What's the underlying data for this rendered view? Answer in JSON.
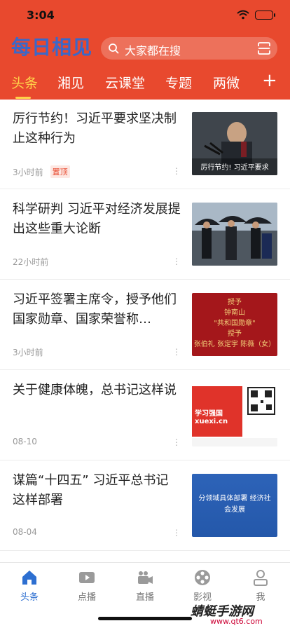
{
  "status_bar": {
    "time": "3:04"
  },
  "header": {
    "logo": "每日相见",
    "search_placeholder": "大家都在搜",
    "tabs": [
      {
        "label": "头条",
        "active": true
      },
      {
        "label": "湘见",
        "active": false
      },
      {
        "label": "云课堂",
        "active": false
      },
      {
        "label": "专题",
        "active": false
      },
      {
        "label": "两微",
        "active": false
      }
    ],
    "plus_label": "+"
  },
  "news": [
    {
      "title": "厉行节约！习近平要求坚决制止这种行为",
      "time": "3小时前",
      "tag": "置顶",
      "thumb_caption": "厉行节约! 习近平要求"
    },
    {
      "title": "科学研判 习近平对经济发展提出这些重大论断",
      "time": "22小时前",
      "tag": "",
      "thumb_caption": ""
    },
    {
      "title": "习近平签署主席令，授予他们国家勋章、国家荣誉称…",
      "time": "3小时前",
      "tag": "",
      "thumb_caption": "授予\n钟南山\n\"共和国勋章\"\n授予\n张伯礼 张定宇 陈薇（女）"
    },
    {
      "title": "关于健康体魄，总书记这样说",
      "time": "08-10",
      "tag": "",
      "thumb_caption": "学习强国 xuexi.cn"
    },
    {
      "title": "谋篇“十四五” 习近平总书记这样部署",
      "time": "08-04",
      "tag": "",
      "thumb_caption": "分领域具体部署 经济社会发展"
    }
  ],
  "bottom_nav": [
    {
      "label": "头条",
      "icon": "home-icon",
      "active": true
    },
    {
      "label": "点播",
      "icon": "play-icon",
      "active": false
    },
    {
      "label": "直播",
      "icon": "video-camera-icon",
      "active": false
    },
    {
      "label": "影视",
      "icon": "film-reel-icon",
      "active": false
    },
    {
      "label": "我",
      "icon": "user-icon",
      "active": false
    }
  ],
  "watermark": {
    "text": "蜻蜓手游网",
    "url": "www.qt6.com"
  },
  "colors": {
    "brand_red": "#e8492e",
    "tab_active": "#ffd34a",
    "nav_active": "#2d6fd1"
  }
}
